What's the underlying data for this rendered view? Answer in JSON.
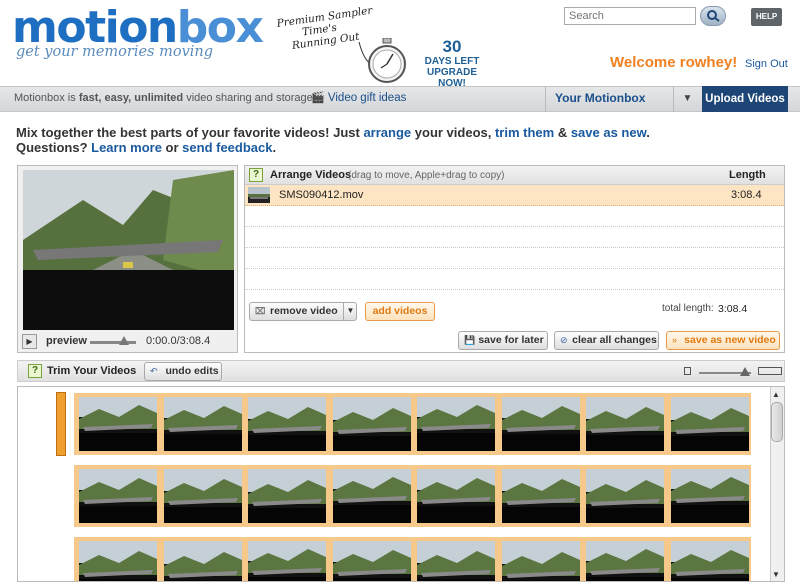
{
  "header": {
    "logo_main": "motion",
    "logo_box": "box",
    "tagline": "get your memories moving",
    "promo_line1": "Premium Sampler",
    "promo_line2": "Time's",
    "promo_line3": "Running Out",
    "days_num": "30",
    "days_line1": "DAYS LEFT",
    "days_line2": "UPGRADE NOW!",
    "search_placeholder": "Search",
    "help_label": "HELP",
    "welcome": "Welcome rowhey!",
    "signout": "Sign Out"
  },
  "nav": {
    "desc_prefix": "Motionbox is ",
    "desc_bold": "fast, easy, unlimited",
    "desc_suffix": " video sharing and storage.",
    "gift": "Video gift ideas",
    "your_motionbox": "Your Motionbox",
    "upload": "Upload Videos"
  },
  "intro": {
    "line1_a": "Mix together the best parts of your favorite videos! Just ",
    "arrange": "arrange",
    "line1_b": " your videos, ",
    "trim": "trim them",
    "line1_c": " & ",
    "save_new": "save as new",
    "line1_d": ".",
    "line2_a": "Questions? ",
    "learn": "Learn more",
    "line2_b": " or ",
    "feedback": "send feedback",
    "line2_c": "."
  },
  "preview": {
    "label": "preview",
    "time": "0:00.0/3:08.4"
  },
  "arrange": {
    "help": "?",
    "title": "Arrange Videos",
    "hint": "(drag to move, Apple+drag to copy)",
    "length_header": "Length",
    "rows": [
      {
        "name": "SMS090412.mov",
        "length": "3:08.4"
      }
    ],
    "remove_label": "remove video",
    "add_label": "add videos",
    "total_label": "total length:",
    "total_value": "3:08.4",
    "save_later": "save for later",
    "clear_all": "clear all changes",
    "save_new": "save as new video"
  },
  "trim": {
    "help": "?",
    "title": "Trim Your Videos",
    "undo": "undo edits"
  },
  "colors": {
    "brand_blue": "#1e6fc2",
    "accent_orange": "#f08020",
    "nav_dark": "#1d4677",
    "strip_orange": "#f6c98b"
  },
  "icons": [
    "stopwatch-icon",
    "search-icon",
    "gift-icon",
    "play-icon",
    "remove-icon",
    "save-icon",
    "clear-icon",
    "save-new-icon",
    "undo-icon",
    "zoom-out-icon",
    "zoom-in-icon"
  ]
}
